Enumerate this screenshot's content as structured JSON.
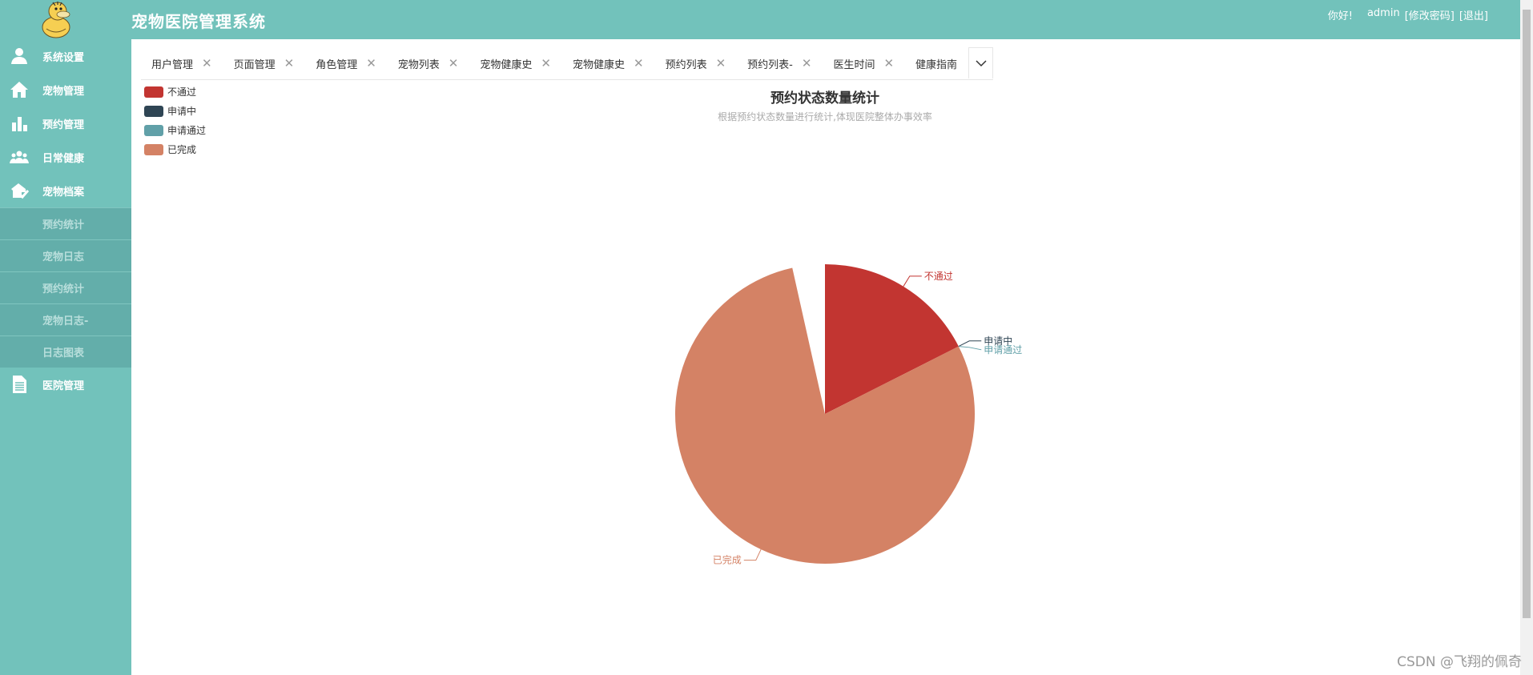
{
  "header": {
    "title": "宠物医院管理系统",
    "greeting": "你好!",
    "username": "admin",
    "change_password": "[修改密码]",
    "logout": "[退出]"
  },
  "sidebar": {
    "items": [
      {
        "label": "系统设置",
        "icon": "user-icon"
      },
      {
        "label": "宠物管理",
        "icon": "home-icon"
      },
      {
        "label": "预约管理",
        "icon": "bar-chart-icon"
      },
      {
        "label": "日常健康",
        "icon": "group-icon"
      },
      {
        "label": "宠物档案",
        "icon": "pet-record-icon"
      }
    ],
    "submenu": [
      "预约统计",
      "宠物日志",
      "预约统计",
      "宠物日志-",
      "日志图表"
    ],
    "last_item": {
      "label": "医院管理",
      "icon": "document-icon"
    }
  },
  "tabs": [
    {
      "label": "用户管理"
    },
    {
      "label": "页面管理"
    },
    {
      "label": "角色管理"
    },
    {
      "label": "宠物列表"
    },
    {
      "label": "宠物健康史"
    },
    {
      "label": "宠物健康史"
    },
    {
      "label": "预约列表"
    },
    {
      "label": "预约列表-"
    },
    {
      "label": "医生时间"
    },
    {
      "label": "健康指南"
    }
  ],
  "close_glyph": "✕",
  "colors": {
    "header_bg": "#72c2bb",
    "submenu_bg": "#63aeaa"
  },
  "chart_data": {
    "type": "pie",
    "title": "预约状态数量统计",
    "subtitle": "根据预约状态数量进行统计,体现医院整体办事效率",
    "legend_position": "top-left",
    "series": [
      {
        "name": "不通过",
        "value": 2,
        "color": "#c23531"
      },
      {
        "name": "申请中",
        "value": 0,
        "color": "#2f4554"
      },
      {
        "name": "申请通过",
        "value": 0,
        "color": "#61a0a8"
      },
      {
        "name": "已完成",
        "value": 9,
        "color": "#d48265"
      }
    ]
  },
  "watermark": "CSDN @飞翔的佩奇"
}
